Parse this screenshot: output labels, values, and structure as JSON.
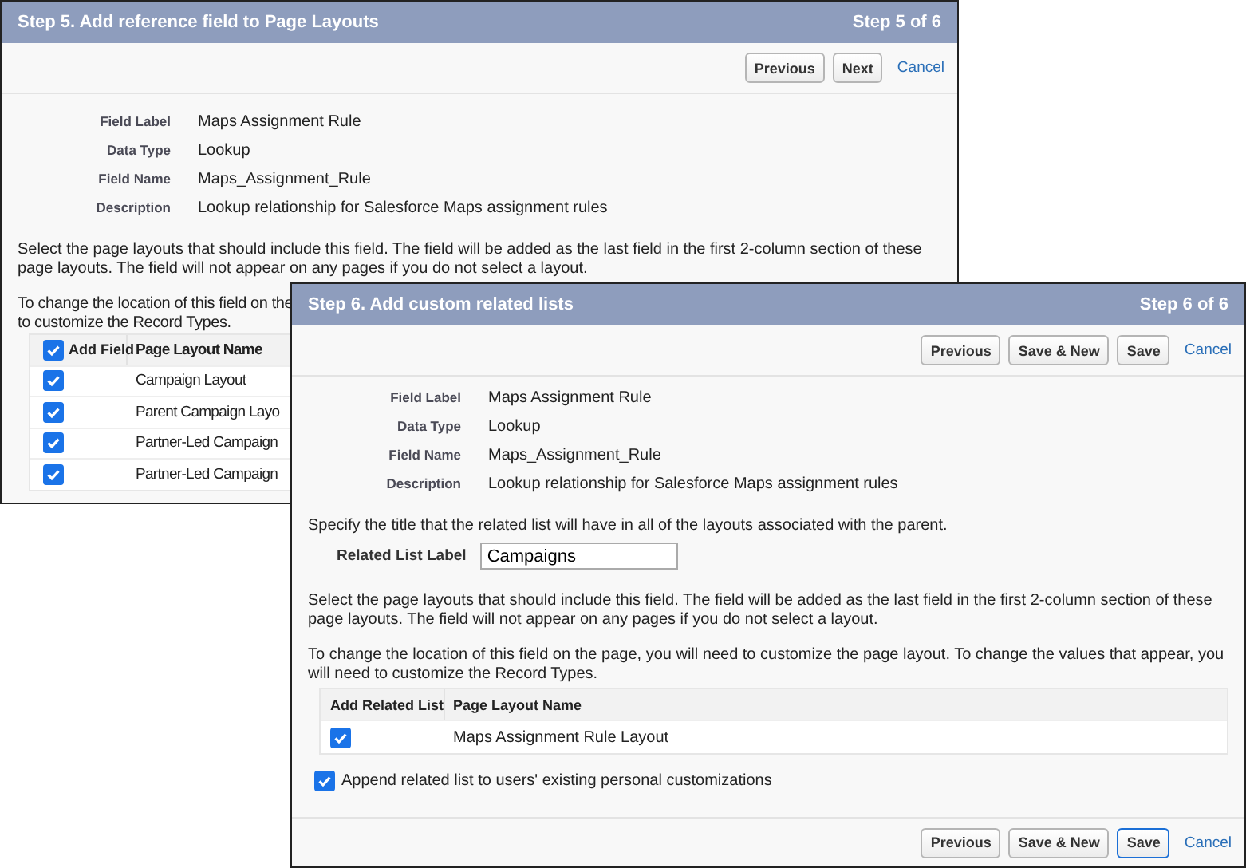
{
  "back_window": {
    "title": "Step 5. Add reference field to Page Layouts",
    "step": "Step 5 of 6",
    "buttons": [
      {
        "label": "Previous",
        "kind": "button"
      },
      {
        "label": "Next",
        "kind": "button"
      },
      {
        "label": "Cancel",
        "kind": "link"
      }
    ],
    "fields": [
      {
        "label": "Field Label",
        "value": "Maps Assignment Rule"
      },
      {
        "label": "Data Type",
        "value": "Lookup"
      },
      {
        "label": "Field Name",
        "value": "Maps_Assignment_Rule"
      },
      {
        "label": "Description",
        "value": "Lookup relationship for Salesforce Maps assignment rules"
      }
    ],
    "select_text": "Select the page layouts that should include this field. The field will be added as the last field in the first 2-column section of these page layouts. The field will not appear on any pages if you do not select a layout.",
    "change_text_lines": [
      "To change the location of this field on the",
      "to customize the Record Types."
    ],
    "table": {
      "columns": [
        "Add Field",
        "Page Layout Name"
      ],
      "all_checked": true,
      "rows": [
        {
          "checked": true,
          "name": "Campaign Layout"
        },
        {
          "checked": true,
          "name": "Parent Campaign Layo"
        },
        {
          "checked": true,
          "name": "Partner-Led Campaign"
        },
        {
          "checked": true,
          "name": "Partner-Led Campaign"
        }
      ]
    }
  },
  "front_window": {
    "title": "Step 6. Add custom related lists",
    "step": "Step 6 of 6",
    "buttons": [
      {
        "label": "Previous",
        "kind": "button",
        "focused": false
      },
      {
        "label": "Save & New",
        "kind": "button",
        "focused": false
      },
      {
        "label": "Save",
        "kind": "button",
        "focused": false
      },
      {
        "label": "Cancel",
        "kind": "link",
        "focused": false
      }
    ],
    "fields": [
      {
        "label": "Field Label",
        "value": "Maps Assignment Rule"
      },
      {
        "label": "Data Type",
        "value": "Lookup"
      },
      {
        "label": "Field Name",
        "value": "Maps_Assignment_Rule"
      },
      {
        "label": "Description",
        "value": "Lookup relationship for Salesforce Maps assignment rules"
      }
    ],
    "specify_text": "Specify the title that the related list will have in all of the layouts associated with the parent.",
    "related_list_label": {
      "label": "Related List Label",
      "value": "Campaigns"
    },
    "select_text": "Select the page layouts that should include this field. The field will be added as the last field in the first 2-column section of these page layouts. The field will not appear on any pages if you do not select a layout.",
    "change_text": "To change the location of this field on the page, you will need to customize the page layout. To change the values that appear, you will need to customize the Record Types.",
    "table": {
      "columns": [
        "Add Related List",
        "Page Layout Name"
      ],
      "rows": [
        {
          "checked": true,
          "name": "Maps Assignment Rule Layout"
        }
      ]
    },
    "append": {
      "label": "Append related list to users' existing personal customizations",
      "checked": true
    },
    "bottom_buttons": [
      {
        "label": "Previous",
        "kind": "button",
        "focused": false
      },
      {
        "label": "Save & New",
        "kind": "button",
        "focused": false
      },
      {
        "label": "Save",
        "kind": "button",
        "focused": true
      },
      {
        "label": "Cancel",
        "kind": "link",
        "focused": false
      }
    ]
  }
}
